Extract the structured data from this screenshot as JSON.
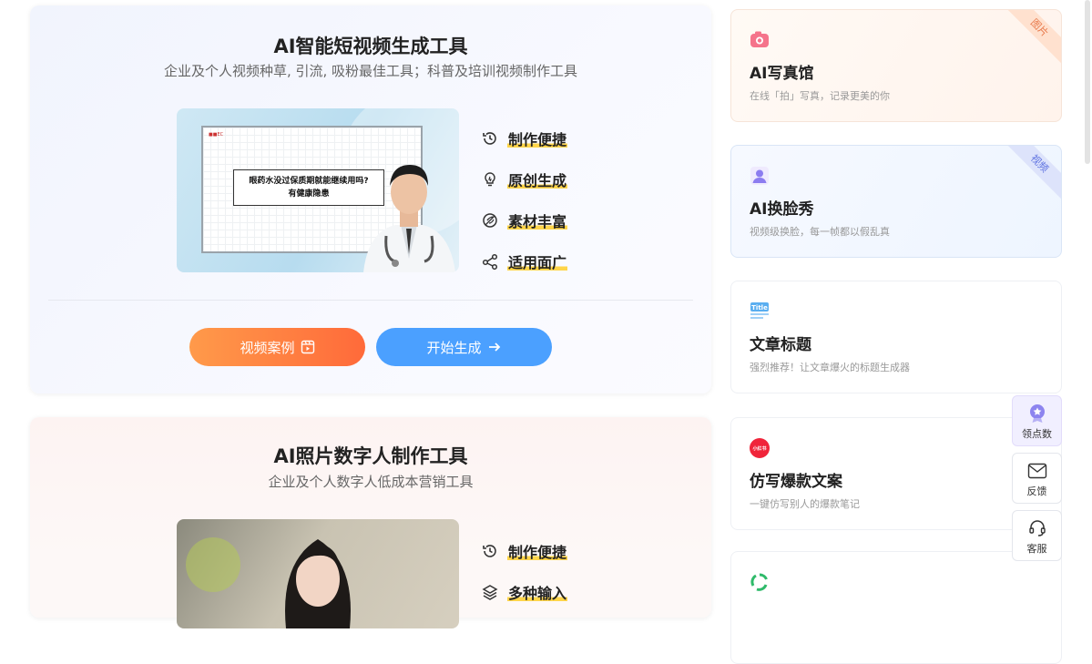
{
  "card1": {
    "title": "AI智能短视频生成工具",
    "subtitle": "企业及个人视频种草, 引流, 吸粉最佳工具；科普及培训视频制作工具",
    "thumb": {
      "tag": "■■EC",
      "question_line1": "眼药水没过保质期就能继续用吗?",
      "question_line2": "有健康隐患"
    },
    "features": [
      {
        "icon": "clock-refresh-icon",
        "label": "制作便捷"
      },
      {
        "icon": "lightbulb-icon",
        "label": "原创生成"
      },
      {
        "icon": "feather-icon",
        "label": "素材丰富"
      },
      {
        "icon": "share-icon",
        "label": "适用面广"
      }
    ],
    "btn_case": "视频案例",
    "btn_start": "开始生成"
  },
  "card2": {
    "title": "AI照片数字人制作工具",
    "subtitle": "企业及个人数字人低成本营销工具",
    "features": [
      {
        "icon": "clock-refresh-icon",
        "label": "制作便捷"
      },
      {
        "icon": "layers-icon",
        "label": "多种输入"
      }
    ]
  },
  "sidebar": [
    {
      "title": "AI写真馆",
      "desc": "在线「拍」写真，记录更美的你",
      "badge": "图片",
      "icon": "camera-icon",
      "color": "#f5748b"
    },
    {
      "title": "AI换脸秀",
      "desc": "视频级换脸，每一帧都以假乱真",
      "badge": "视频",
      "icon": "portrait-icon",
      "color": "#8c7cf0"
    },
    {
      "title": "文章标题",
      "desc": "强烈推荐！让文章爆火的标题生成器",
      "badge": "",
      "icon": "title-doc-icon",
      "color": "#5aaef0",
      "icon_text": "Title"
    },
    {
      "title": "仿写爆款文案",
      "desc": "一键仿写别人的爆款笔记",
      "badge": "",
      "icon": "xiaohongshu-icon",
      "color": "#f0243a",
      "icon_text": "小红书"
    },
    {
      "title": "",
      "desc": "",
      "badge": "",
      "icon": "recycle-icon",
      "color": "#2fba6a"
    }
  ],
  "floating": [
    {
      "label": "领点数",
      "icon": "medal-icon"
    },
    {
      "label": "反馈",
      "icon": "mail-icon"
    },
    {
      "label": "客服",
      "icon": "headset-icon"
    }
  ]
}
